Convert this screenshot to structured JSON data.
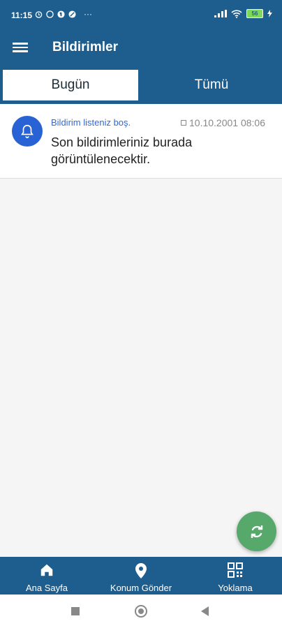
{
  "status_bar": {
    "time": "11:15",
    "more": "···",
    "battery": "56"
  },
  "app_bar": {
    "title": "Bildirimler"
  },
  "tabs": [
    {
      "label": "Bugün"
    },
    {
      "label": "Tümü"
    }
  ],
  "notification": {
    "title": "Bildirim listeniz boş.",
    "date": "10.10.2001 08:06",
    "body": "Son bildirimleriniz burada görüntülenecektir."
  },
  "bottom_nav": [
    {
      "label": "Ana Sayfa",
      "icon": "home-icon"
    },
    {
      "label": "Konum Gönder",
      "icon": "location-pin-icon"
    },
    {
      "label": "Yoklama",
      "icon": "qr-code-icon"
    }
  ],
  "colors": {
    "primary": "#1e5e8f",
    "accent_blue": "#2962d4",
    "fab_green": "#57a96b"
  }
}
